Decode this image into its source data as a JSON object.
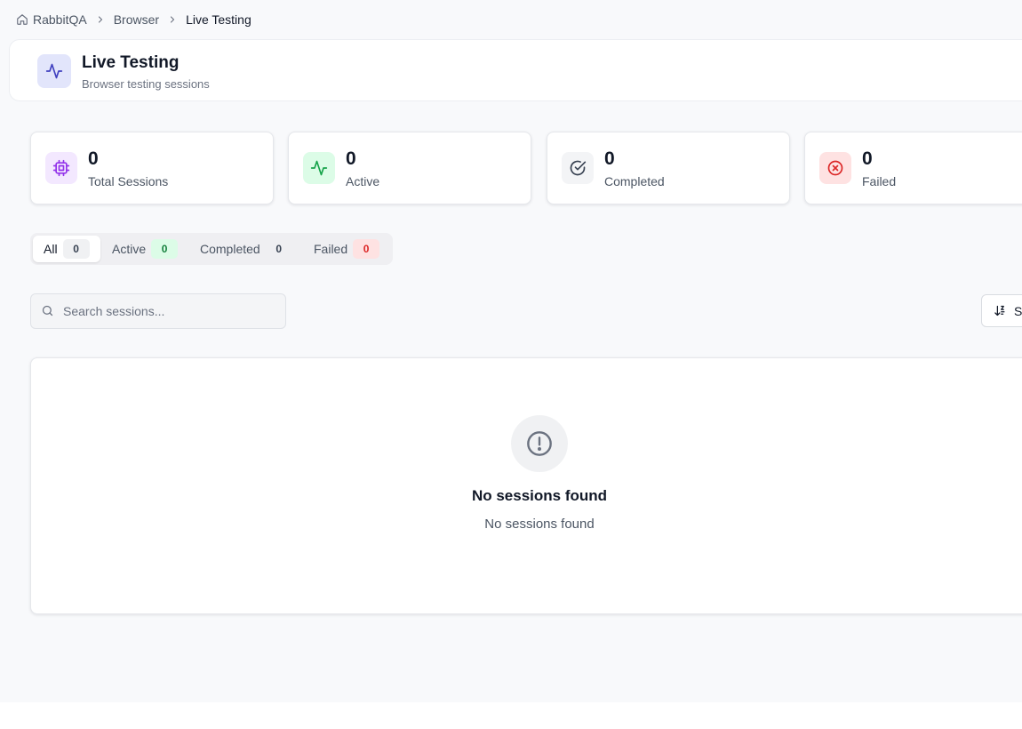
{
  "breadcrumb": {
    "items": [
      {
        "label": "RabbitQA",
        "icon": "home-icon"
      },
      {
        "label": "Browser"
      },
      {
        "label": "Live Testing"
      }
    ],
    "separator_icon": "chevron-right-icon"
  },
  "header": {
    "icon": "activity-icon",
    "title": "Live Testing",
    "subtitle": "Browser testing sessions",
    "icon_color": "#3f3fbf",
    "icon_bg": "#e2e5fb"
  },
  "stats": [
    {
      "value": "0",
      "label": "Total Sessions",
      "icon": "cpu-icon",
      "color": "#9333ea",
      "bg": "#f3e8ff"
    },
    {
      "value": "0",
      "label": "Active",
      "icon": "activity-icon",
      "color": "#16a34a",
      "bg": "#dcfce7"
    },
    {
      "value": "0",
      "label": "Completed",
      "icon": "check-circle-icon",
      "color": "#374151",
      "bg": "#f3f4f6"
    },
    {
      "value": "0",
      "label": "Failed",
      "icon": "x-circle-icon",
      "color": "#dc2626",
      "bg": "#fee2e2"
    }
  ],
  "tabs": [
    {
      "label": "All",
      "count": "0",
      "selected": true
    },
    {
      "label": "Active",
      "count": "0",
      "selected": false,
      "badge_color": "#15803d",
      "badge_bg": "#dcfce7"
    },
    {
      "label": "Completed",
      "count": "0",
      "selected": false
    },
    {
      "label": "Failed",
      "count": "0",
      "selected": false,
      "badge_color": "#dc2626",
      "badge_bg": "#fee2e2"
    }
  ],
  "search": {
    "placeholder": "Search sessions...",
    "value": "",
    "icon": "search-icon"
  },
  "sort": {
    "label": "S",
    "icon": "sort-icon"
  },
  "empty_state": {
    "icon": "alert-circle-icon",
    "title": "No sessions found",
    "message": "No sessions found"
  }
}
